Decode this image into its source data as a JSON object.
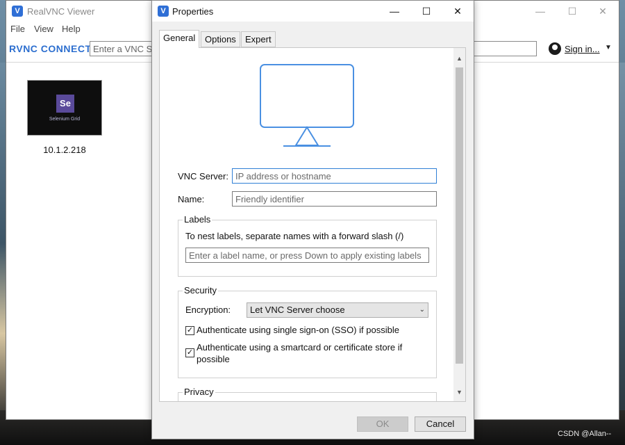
{
  "main_window": {
    "title": "RealVNC Viewer",
    "menu": [
      "File",
      "View",
      "Help"
    ],
    "brand": "RVNC CONNECT",
    "search_placeholder": "Enter a VNC Server address or search",
    "sign_in": "Sign in...",
    "computers": [
      {
        "label": "10.1.2.218",
        "thumbnail_text": "Selenium Grid",
        "thumbnail_logo": "Se"
      }
    ]
  },
  "dialog": {
    "title": "Properties",
    "tabs": [
      "General",
      "Options",
      "Expert"
    ],
    "active_tab": "General",
    "icon": "monitor-icon",
    "vnc_server_label": "VNC Server:",
    "vnc_server_placeholder": "IP address or hostname",
    "name_label": "Name:",
    "name_placeholder": "Friendly identifier",
    "labels": {
      "heading": "Labels",
      "hint": "To nest labels, separate names with a forward slash (/)",
      "placeholder": "Enter a label name, or press Down to apply existing labels"
    },
    "security": {
      "heading": "Security",
      "encryption_label": "Encryption:",
      "encryption_value": "Let VNC Server choose",
      "sso_label": "Authenticate using single sign-on (SSO) if possible",
      "sso_checked": true,
      "smartcard_label_line1": "Authenticate using a smartcard or certificate store if",
      "smartcard_label_line2": "possible",
      "smartcard_checked": true
    },
    "privacy_heading": "Privacy",
    "ok_label": "OK",
    "cancel_label": "Cancel"
  },
  "watermark": "CSDN @Allan--",
  "colors": {
    "accent": "#2f7fd6",
    "monitor_stroke": "#4a90e2",
    "brand": "#2d6fcf"
  }
}
